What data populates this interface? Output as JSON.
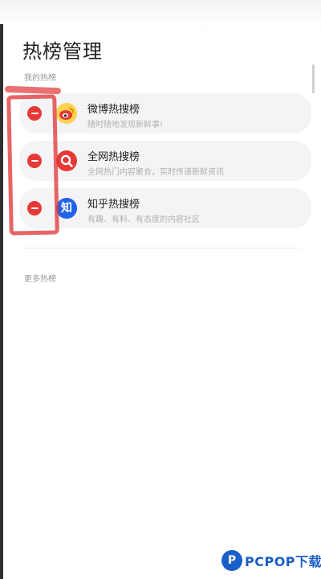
{
  "header": {
    "title": "热榜管理"
  },
  "sections": {
    "mine": "我的热榜",
    "more": "更多热榜"
  },
  "hot_lists": [
    {
      "title": "微博热搜榜",
      "description": "随时随地发现新鲜事!",
      "icon": "weibo-icon",
      "color": "#fcd34d"
    },
    {
      "title": "全网热搜榜",
      "description": "全网热门内容聚合，实时传递新鲜资讯",
      "icon": "search-icon",
      "color": "#e53935"
    },
    {
      "title": "知乎热搜榜",
      "description": "有趣、有料、有态度的内容社区",
      "icon": "zhihu-icon",
      "icon_text": "知",
      "color": "#1e63e8"
    }
  ],
  "remove_color": "#e53935",
  "annotation_color": "#e03a3a",
  "watermark": {
    "text": "PCPOP下载",
    "badge": "P",
    "color": "#1a5ec7"
  }
}
